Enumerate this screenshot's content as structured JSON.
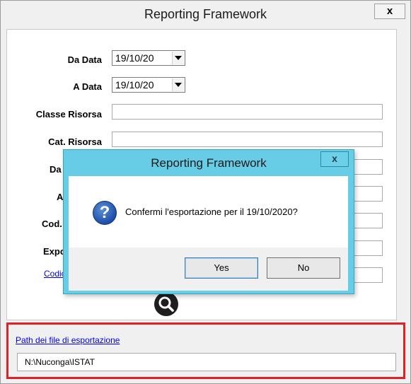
{
  "window": {
    "title": "Reporting Framework",
    "close_label": "x"
  },
  "form": {
    "da_data": {
      "label": "Da Data",
      "value": "19/10/20"
    },
    "a_data": {
      "label": "A Data",
      "value": "19/10/20"
    },
    "classe_risorsa": {
      "label": "Classe Risorsa"
    },
    "cat_risorsa": {
      "label": "Cat. Risorsa"
    },
    "row5_label": "Da",
    "row6_label": "A",
    "row7_label": "Cod.",
    "row8_label": "Expo",
    "link_partial": "Codic"
  },
  "path_section": {
    "link": "Path dei file di esportazione",
    "value": "N:\\Nuconga\\ISTAT"
  },
  "dialog": {
    "title": "Reporting Framework",
    "close_label": "x",
    "message": "Confermi l'esportazione per il  19/10/2020?",
    "yes": "Yes",
    "no": "No",
    "icon": "question-icon"
  },
  "colors": {
    "dialog_frame": "#67cde6",
    "highlight": "#e01f26",
    "link": "#0000ee"
  }
}
